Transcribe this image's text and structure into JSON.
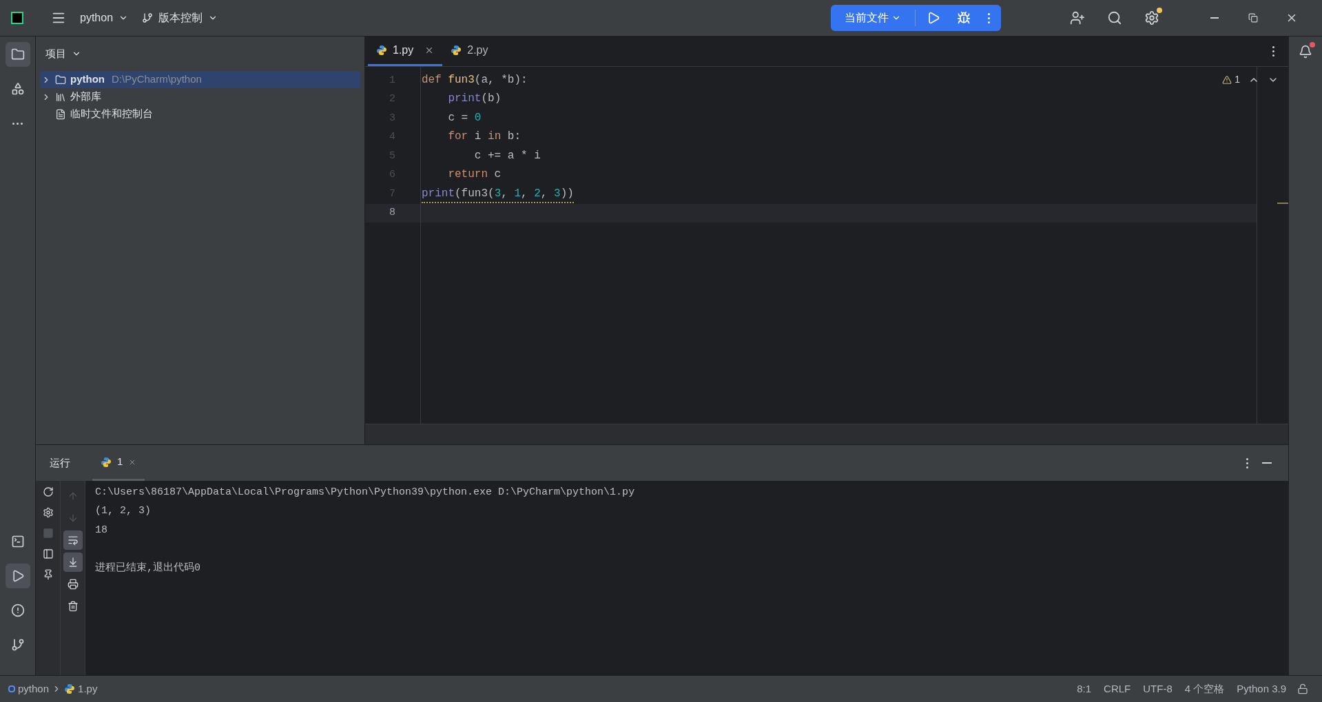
{
  "title_bar": {
    "project": "python",
    "vcs": "版本控制",
    "run_config": "当前文件"
  },
  "project_panel": {
    "title": "项目",
    "items": [
      {
        "kind": "folder",
        "label": "python",
        "path": "D:\\PyCharm\\python",
        "selected": true,
        "expanded": false
      },
      {
        "kind": "library",
        "label": "外部库",
        "selected": false,
        "expanded": false
      },
      {
        "kind": "scratch",
        "label": "临时文件和控制台",
        "selected": false
      }
    ]
  },
  "editor": {
    "tabs": [
      {
        "label": "1.py",
        "selected": true,
        "closable": true
      },
      {
        "label": "2.py",
        "selected": false,
        "closable": false
      }
    ],
    "warnings": "1",
    "lines": [
      {
        "number": "1",
        "selected": false,
        "warning": false,
        "tokens": [
          {
            "text": "def ",
            "kind": "keyword"
          },
          {
            "text": "fun3",
            "kind": "funcdef"
          },
          {
            "text": "(a, *b):",
            "kind": "plain"
          }
        ]
      },
      {
        "number": "2",
        "selected": false,
        "warning": false,
        "tokens": [
          {
            "text": "    print",
            "kind": "builtin"
          },
          {
            "text": "(b)",
            "kind": "plain"
          }
        ]
      },
      {
        "number": "3",
        "selected": false,
        "warning": false,
        "tokens": [
          {
            "text": "    c = ",
            "kind": "plain"
          },
          {
            "text": "0",
            "kind": "number"
          }
        ]
      },
      {
        "number": "4",
        "selected": false,
        "warning": false,
        "tokens": [
          {
            "text": "    for",
            "kind": "keyword"
          },
          {
            "text": " i ",
            "kind": "plain"
          },
          {
            "text": "in",
            "kind": "keyword"
          },
          {
            "text": " b:",
            "kind": "plain"
          }
        ]
      },
      {
        "number": "5",
        "selected": false,
        "warning": false,
        "tokens": [
          {
            "text": "        c += a * i",
            "kind": "plain"
          }
        ]
      },
      {
        "number": "6",
        "selected": false,
        "warning": false,
        "tokens": [
          {
            "text": "    return",
            "kind": "keyword"
          },
          {
            "text": " c",
            "kind": "plain"
          }
        ]
      },
      {
        "number": "7",
        "selected": false,
        "warning": true,
        "tokens": [
          {
            "text": "print",
            "kind": "builtin"
          },
          {
            "text": "(fun3(",
            "kind": "plain"
          },
          {
            "text": "3",
            "kind": "number"
          },
          {
            "text": ", ",
            "kind": "plain"
          },
          {
            "text": "1",
            "kind": "number"
          },
          {
            "text": ", ",
            "kind": "plain"
          },
          {
            "text": "2",
            "kind": "number"
          },
          {
            "text": ", ",
            "kind": "plain"
          },
          {
            "text": "3",
            "kind": "number"
          },
          {
            "text": "))",
            "kind": "plain"
          }
        ]
      },
      {
        "number": "8",
        "selected": true
      }
    ]
  },
  "run_panel": {
    "tabs": [
      {
        "label": "运行",
        "kind": "title",
        "selected": false
      },
      {
        "label": "1",
        "kind": "python",
        "selected": true
      }
    ],
    "tools_left": [
      {
        "kind": "rerun",
        "disabled": false
      },
      {
        "kind": "settings",
        "disabled": false
      },
      {
        "kind": "stop",
        "disabled": true
      },
      {
        "kind": "layout",
        "disabled": false
      },
      {
        "kind": "pin",
        "disabled": false
      }
    ],
    "tools_right": [
      {
        "kind": "up",
        "on": false,
        "disabled": true
      },
      {
        "kind": "down",
        "on": false,
        "disabled": true
      },
      {
        "kind": "wrap",
        "on": true,
        "disabled": false
      },
      {
        "kind": "scroll-end",
        "on": true,
        "disabled": false
      },
      {
        "kind": "print",
        "on": false,
        "disabled": false
      },
      {
        "kind": "trash",
        "on": false,
        "disabled": false
      }
    ],
    "output": [
      {
        "kind": "command",
        "text": "C:\\Users\\86187\\AppData\\Local\\Programs\\Python\\Python39\\python.exe D:\\PyCharm\\python\\1.py"
      },
      {
        "kind": "stdout",
        "text": "(1, 2, 3)"
      },
      {
        "kind": "stdout",
        "text": "18"
      },
      {
        "kind": "exit",
        "text": "进程已结束,退出代码0"
      }
    ]
  },
  "status_bar": {
    "breadcrumbs": [
      {
        "kind": "module",
        "label": "python"
      },
      {
        "kind": "python",
        "label": "1.py"
      }
    ],
    "items": [
      "8:1",
      "CRLF",
      "UTF-8",
      "4 个空格",
      "Python 3.9"
    ]
  }
}
